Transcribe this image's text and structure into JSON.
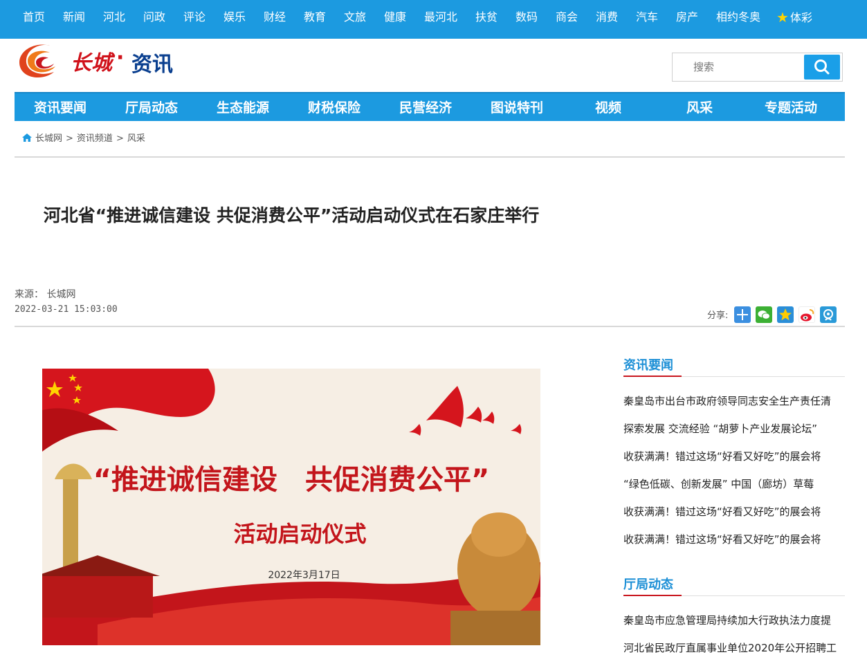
{
  "topnav": [
    "首页",
    "新闻",
    "河北",
    "问政",
    "评论",
    "娱乐",
    "财经",
    "教育",
    "文旅",
    "健康",
    "最河北",
    "扶贫",
    "数码",
    "商会",
    "消费",
    "汽车",
    "房产",
    "相约冬奥",
    "体彩"
  ],
  "logo": {
    "brand": "长城",
    "dot": "·",
    "section": "资讯"
  },
  "search": {
    "placeholder": "搜索"
  },
  "mainnav": [
    "资讯要闻",
    "厅局动态",
    "生态能源",
    "财税保险",
    "民营经济",
    "图说特刊",
    "视频",
    "风采",
    "专题活动"
  ],
  "breadcrumb": {
    "home": "长城网",
    "sep1": ">",
    "channel": "资讯频道",
    "sep2": ">",
    "current": "风采"
  },
  "article": {
    "title": "河北省“推进诚信建设 共促消费公平”活动启动仪式在石家庄举行",
    "source": "来源： 长城网",
    "date": "2022-03-21 15:03:00",
    "share_label": "分享:"
  },
  "banner": {
    "title": "“推进诚信建设　共促消费公平”",
    "subtitle": "活动启动仪式",
    "date": "2022年3月17日"
  },
  "sidebar": {
    "section1": {
      "heading": "资讯要闻",
      "items": [
        "秦皇岛市出台市政府领导同志安全生产责任清",
        "探索发展 交流经验 “胡萝卜产业发展论坛”",
        "收获满满！错过这场“好看又好吃”的展会将",
        "“绿色低碳、创新发展” 中国（廊坊）草莓",
        "收获满满！错过这场“好看又好吃”的展会将",
        "收获满满！错过这场“好看又好吃”的展会将"
      ]
    },
    "section2": {
      "heading": "厅局动态",
      "items": [
        "秦皇岛市应急管理局持续加大行政执法力度提",
        "河北省民政厅直属事业单位2020年公开招聘工"
      ]
    }
  },
  "colors": {
    "primary": "#1c9ae0",
    "brand_red": "#d0121b",
    "brand_blue": "#0a3f8f",
    "accent": "#c8161e"
  }
}
